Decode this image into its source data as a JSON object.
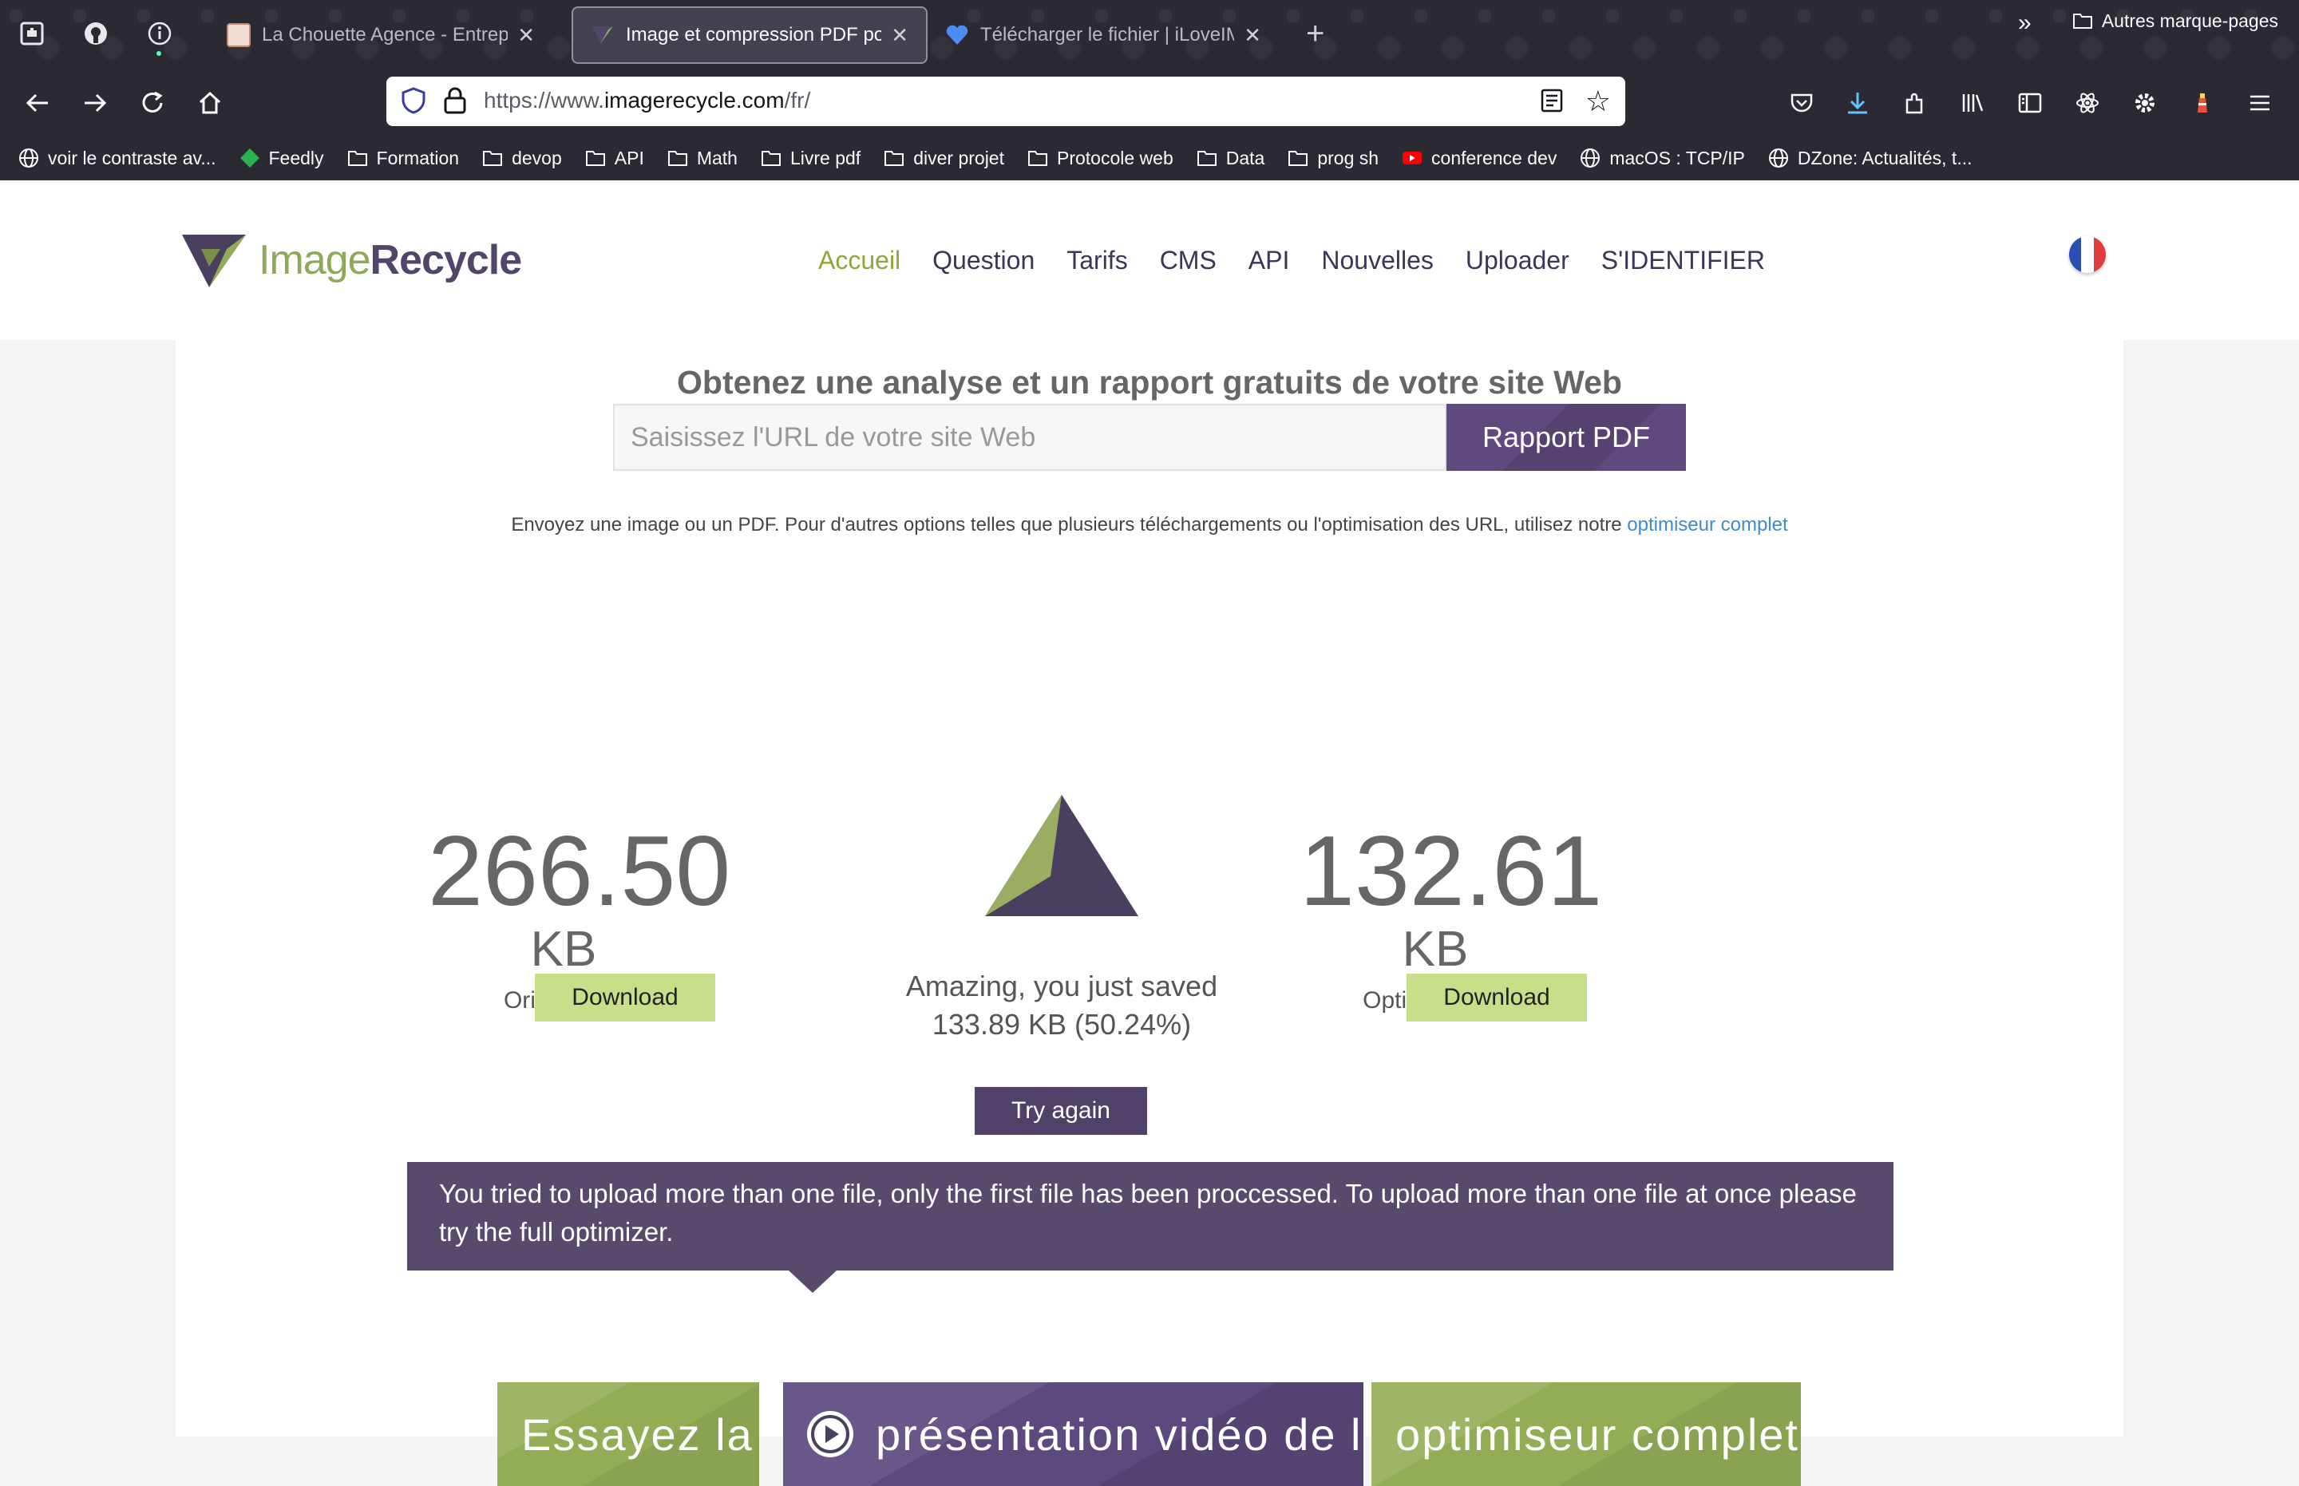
{
  "browser": {
    "tabs": [
      {
        "title": "La Chouette Agence - Entreprise",
        "active": false
      },
      {
        "title": "Image et compression PDF pour",
        "active": true
      },
      {
        "title": "Télécharger le fichier | iLoveIMG",
        "active": false
      }
    ],
    "url_prefix": "https://www.",
    "url_domain": "imagerecycle.com",
    "url_path": "/fr/",
    "bookmarks": [
      {
        "label": "voir le contraste av...",
        "icon": "globe-icon"
      },
      {
        "label": "Feedly",
        "icon": "feedly-icon"
      },
      {
        "label": "Formation",
        "icon": "folder-icon"
      },
      {
        "label": "devop",
        "icon": "folder-icon"
      },
      {
        "label": "API",
        "icon": "folder-icon"
      },
      {
        "label": "Math",
        "icon": "folder-icon"
      },
      {
        "label": "Livre pdf",
        "icon": "folder-icon"
      },
      {
        "label": "diver projet",
        "icon": "folder-icon"
      },
      {
        "label": "Protocole web",
        "icon": "folder-icon"
      },
      {
        "label": "Data",
        "icon": "folder-icon"
      },
      {
        "label": "prog sh",
        "icon": "folder-icon"
      },
      {
        "label": "conference dev",
        "icon": "youtube-icon"
      },
      {
        "label": "macOS : TCP/IP",
        "icon": "globe-icon"
      },
      {
        "label": "DZone: Actualités, t...",
        "icon": "globe-icon"
      }
    ],
    "other_bookmarks": "Autres marque-pages"
  },
  "site": {
    "logo_light": "Image",
    "logo_bold": "Recycle",
    "nav": [
      "Accueil",
      "Question",
      "Tarifs",
      "CMS",
      "API",
      "Nouvelles",
      "Uploader",
      "S'IDENTIFIER"
    ],
    "nav_active": "Accueil",
    "headline": "Obtenez une analyse et un rapport gratuits de votre site Web",
    "url_placeholder": "Saisissez l'URL de votre site Web",
    "report_button": "Rapport PDF",
    "note_text": "Envoyez une image ou un PDF. Pour d'autres options telles que plusieurs téléchargements ou l'optimisation des URL, utilisez notre",
    "note_link": "optimiseur complet",
    "original": {
      "size": "266.50",
      "unit": "KB",
      "label": "Original file",
      "button": "Download"
    },
    "optimized": {
      "size": "132.61",
      "unit": "KB",
      "label": "Optimized file",
      "button": "Download"
    },
    "saved_line1": "Amazing, you just saved",
    "saved_line2": "133.89 KB (50.24%)",
    "try_again": "Try again",
    "alert": "You tried to upload more than one file, only the first file has been proccessed. To upload more than one file at once please try the full optimizer.",
    "cta": [
      "Essayez la",
      "présentation vidéo de l'",
      "optimiseur complet"
    ]
  },
  "colors": {
    "brand_purple": "#5f4a7e",
    "brand_green": "#93ad55",
    "download_green": "#c8df8a",
    "link_blue": "#3f8ad0"
  }
}
